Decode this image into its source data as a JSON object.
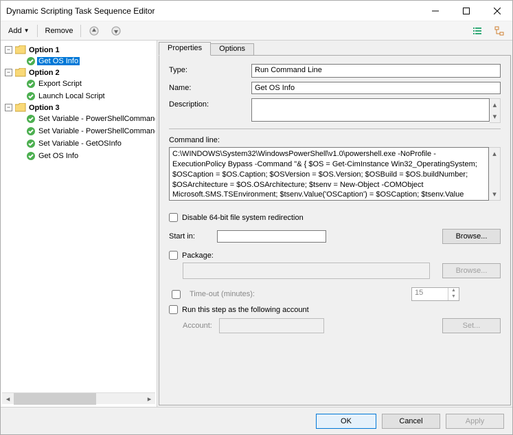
{
  "window": {
    "title": "Dynamic Scripting Task Sequence Editor"
  },
  "toolbar": {
    "add": "Add",
    "remove": "Remove"
  },
  "tree": {
    "groups": [
      {
        "label": "Option 1",
        "children": [
          {
            "label": "Get OS Info",
            "selected": true
          }
        ]
      },
      {
        "label": "Option 2",
        "children": [
          {
            "label": "Export Script"
          },
          {
            "label": "Launch Local Script"
          }
        ]
      },
      {
        "label": "Option 3",
        "children": [
          {
            "label": "Set Variable - PowerShellCommand"
          },
          {
            "label": "Set Variable - PowerShellCommand"
          },
          {
            "label": "Set Variable - GetOSInfo"
          },
          {
            "label": "Get OS Info"
          }
        ]
      }
    ]
  },
  "tabs": {
    "properties": "Properties",
    "options": "Options"
  },
  "props": {
    "type_label": "Type:",
    "type_value": "Run Command Line",
    "name_label": "Name:",
    "name_value": "Get OS Info",
    "desc_label": "Description:",
    "desc_value": "",
    "cmd_label": "Command line:",
    "cmd_value": "C:\\WINDOWS\\System32\\WindowsPowerShell\\v1.0\\powershell.exe -NoProfile -ExecutionPolicy Bypass -Command \"& { $OS = Get-CimInstance Win32_OperatingSystem; $OSCaption = $OS.Caption; $OSVersion = $OS.Version; $OSBuild = $OS.buildNumber; $OSArchitecture = $OS.OSArchitecture; $tsenv = New-Object -COMObject Microsoft.SMS.TSEnvironment; $tsenv.Value('OSCaption') = $OSCaption; $tsenv.Value",
    "disable64": "Disable 64-bit file system redirection",
    "startin_label": "Start in:",
    "startin_value": "",
    "browse": "Browse...",
    "package": "Package:",
    "timeout": "Time-out (minutes):",
    "timeout_value": "15",
    "runas": "Run this step as the following account",
    "account_label": "Account:",
    "set": "Set..."
  },
  "footer": {
    "ok": "OK",
    "cancel": "Cancel",
    "apply": "Apply"
  }
}
